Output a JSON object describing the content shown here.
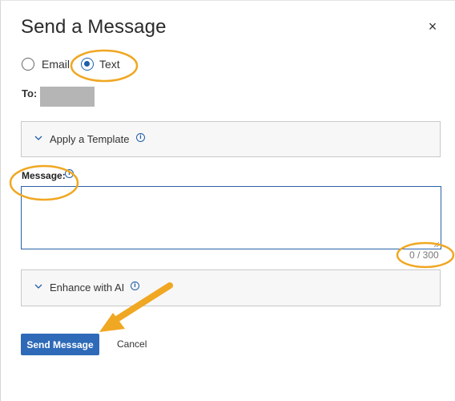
{
  "dialog": {
    "title": "Send a Message",
    "close_symbol": "×"
  },
  "channel": {
    "options": [
      {
        "label": "Email",
        "selected": false
      },
      {
        "label": "Text",
        "selected": true
      }
    ]
  },
  "to": {
    "label": "To:",
    "value_redacted": true
  },
  "template_panel": {
    "label": "Apply a Template",
    "icon": "info-icon",
    "expanded": false
  },
  "message": {
    "label": "Message:",
    "value": "",
    "counter": "0 / 300"
  },
  "enhance_panel": {
    "label": "Enhance with AI",
    "icon": "info-icon",
    "expanded": false
  },
  "actions": {
    "send_label": "Send Message",
    "cancel_label": "Cancel"
  },
  "colors": {
    "accent": "#2e6ab7",
    "annotation": "#f0a722"
  }
}
